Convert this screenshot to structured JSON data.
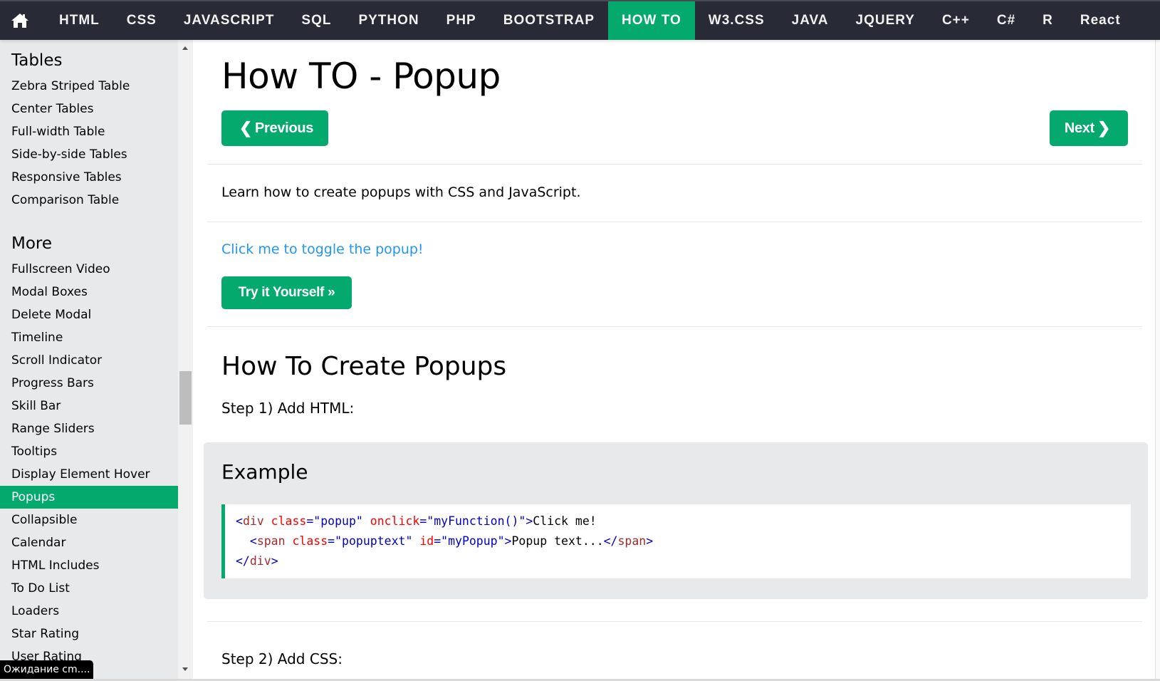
{
  "nav": {
    "home_icon": "home-icon",
    "items": [
      "HTML",
      "CSS",
      "JAVASCRIPT",
      "SQL",
      "PYTHON",
      "PHP",
      "BOOTSTRAP",
      "HOW TO",
      "W3.CSS",
      "JAVA",
      "JQUERY",
      "C++",
      "C#",
      "R",
      "React"
    ],
    "active": "HOW TO",
    "colors": {
      "bar": "#282a35",
      "active": "#04aa6d"
    }
  },
  "sidebar": {
    "sections": [
      {
        "heading": "Tables",
        "items": [
          "Zebra Striped Table",
          "Center Tables",
          "Full-width Table",
          "Side-by-side Tables",
          "Responsive Tables",
          "Comparison Table"
        ]
      },
      {
        "heading": "More",
        "items": [
          "Fullscreen Video",
          "Modal Boxes",
          "Delete Modal",
          "Timeline",
          "Scroll Indicator",
          "Progress Bars",
          "Skill Bar",
          "Range Sliders",
          "Tooltips",
          "Display Element Hover",
          "Popups",
          "Collapsible",
          "Calendar",
          "HTML Includes",
          "To Do List",
          "Loaders",
          "Star Rating",
          "User Rating"
        ]
      }
    ],
    "active": "Popups"
  },
  "status_tooltip": "Ожидание cm....",
  "main": {
    "title": "How TO - Popup",
    "prev_label": "Previous",
    "next_label": "Next",
    "intro": "Learn how to create popups with CSS and JavaScript.",
    "toggle_link": "Click me to toggle the popup!",
    "try_label": "Try it Yourself »",
    "section_heading": "How To Create Popups",
    "step1": "Step 1) Add HTML:",
    "example_heading": "Example",
    "code": {
      "line1": {
        "open": "<",
        "tag": "div",
        "attr1": " class",
        "eq1": "=",
        "val1": "\"popup\"",
        "attr2": " onclick",
        "eq2": "=",
        "val2": "\"myFunction()\"",
        "close": ">",
        "text": "Click me!"
      },
      "line2": {
        "indent": "  ",
        "open": "<",
        "tag": "span",
        "attr1": " class",
        "eq1": "=",
        "val1": "\"popuptext\"",
        "attr2": " id",
        "eq2": "=",
        "val2": "\"myPopup\"",
        "close": ">",
        "text": "Popup text...",
        "end_open": "</",
        "end_tag": "span",
        "end_close": ">"
      },
      "line3": {
        "open": "</",
        "tag": "div",
        "close": ">"
      }
    },
    "step2": "Step 2) Add CSS:"
  }
}
